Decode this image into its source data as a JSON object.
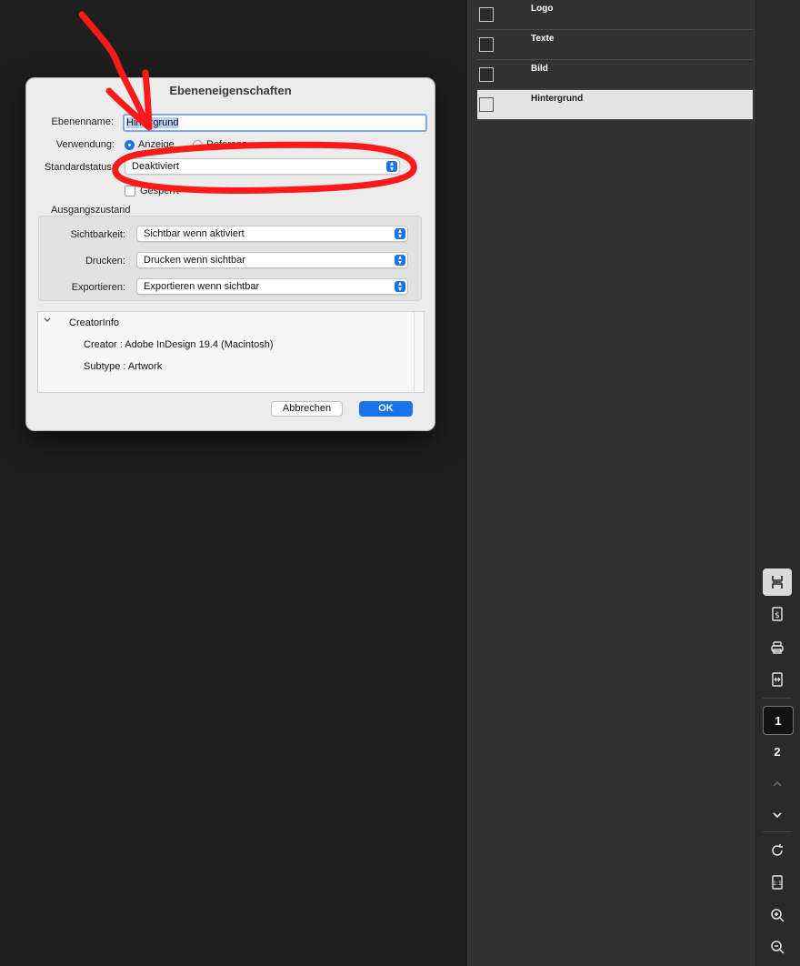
{
  "layers": [
    {
      "name": "Logo",
      "selected": false
    },
    {
      "name": "Texte",
      "selected": false
    },
    {
      "name": "Bild",
      "selected": false
    },
    {
      "name": "Hintergrund",
      "selected": true
    }
  ],
  "dialog": {
    "title": "Ebeneneigenschaften",
    "layer_name_label": "Ebenenname:",
    "layer_name_selected": "Hintergrund",
    "usage_label": "Verwendung:",
    "usage_options": [
      "Anzeige",
      "Referenz"
    ],
    "usage_selected": "Anzeige",
    "default_state_label": "Standardstatus:",
    "default_state_value": "Deaktiviert",
    "locked_label": "Gesperrt",
    "initial_state_heading": "Ausgangszustand",
    "visibility_label": "Sichtbarkeit:",
    "visibility_value": "Sichtbar wenn aktiviert",
    "print_label": "Drucken:",
    "print_value": "Drucken wenn sichtbar",
    "export_label": "Exportieren:",
    "export_value": "Exportieren wenn sichtbar",
    "creator_info_heading": "CreatorInfo",
    "creator_line": "Creator : Adobe InDesign 19.4 (Macintosh)",
    "subtype_line": "Subtype : Artwork",
    "cancel_label": "Abbrechen",
    "ok_label": "OK"
  },
  "toolbar": {
    "pages": [
      "1",
      "2"
    ],
    "current_page": "1",
    "icons": [
      "layers-icon",
      "page-dollar-icon",
      "print-icon",
      "compare-icon",
      "chevron-up-icon",
      "chevron-down-icon",
      "rotate-icon",
      "actual-size-icon",
      "zoom-in-icon",
      "zoom-out-icon"
    ]
  },
  "colors": {
    "accent": "#1a73e8",
    "annotation": "#ff0000",
    "panel": "#323232",
    "background": "#1e1e1e"
  }
}
